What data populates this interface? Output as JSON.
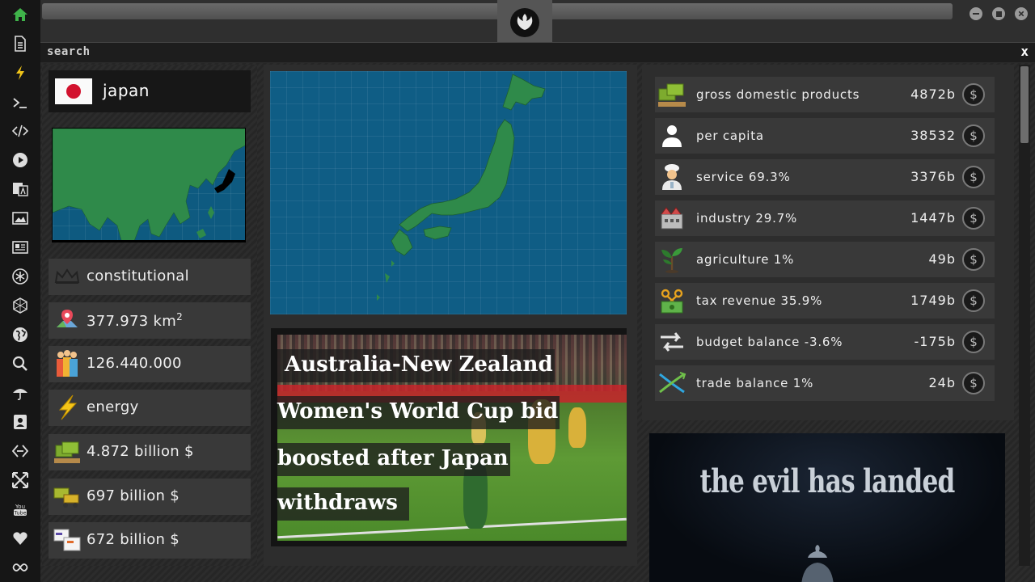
{
  "search": {
    "label": "search",
    "close": "x"
  },
  "country": {
    "name": "japan"
  },
  "facts": {
    "government": "constitutional",
    "area_value": "377.973 km",
    "area_sup": "2",
    "population": "126.440.000",
    "sector": "energy",
    "gdp": "4.872 billion $",
    "metric_2": "697 billion $",
    "metric_3": "672 billion $"
  },
  "news": {
    "lines": [
      " Australia-New Zealand",
      "Women's World Cup bid",
      "boosted after Japan",
      "withdraws"
    ]
  },
  "economy": [
    {
      "label": "gross domestic products",
      "value": "4872b",
      "icon": "money-pallet-icon"
    },
    {
      "label": "per capita",
      "value": "38532",
      "icon": "person-icon"
    },
    {
      "label": "service 69.3%",
      "value": "3376b",
      "icon": "chef-icon"
    },
    {
      "label": "industry 29.7%",
      "value": "1447b",
      "icon": "factory-icon"
    },
    {
      "label": "agriculture 1%",
      "value": "49b",
      "icon": "sprout-icon"
    },
    {
      "label": "tax revenue 35.9%",
      "value": "1749b",
      "icon": "scissors-money-icon"
    },
    {
      "label": "budget balance -3.6%",
      "value": "-175b",
      "icon": "balance-arrows-icon"
    },
    {
      "label": "trade balance 1%",
      "value": "24b",
      "icon": "trade-cross-icon"
    }
  ],
  "currency_symbol": "$",
  "promo": {
    "title": "the evil has landed"
  },
  "colors": {
    "map_sea": "#0f5d85",
    "map_land": "#2f8a4a",
    "accent_green": "#3fb34a",
    "flag_red": "#d2122e"
  }
}
